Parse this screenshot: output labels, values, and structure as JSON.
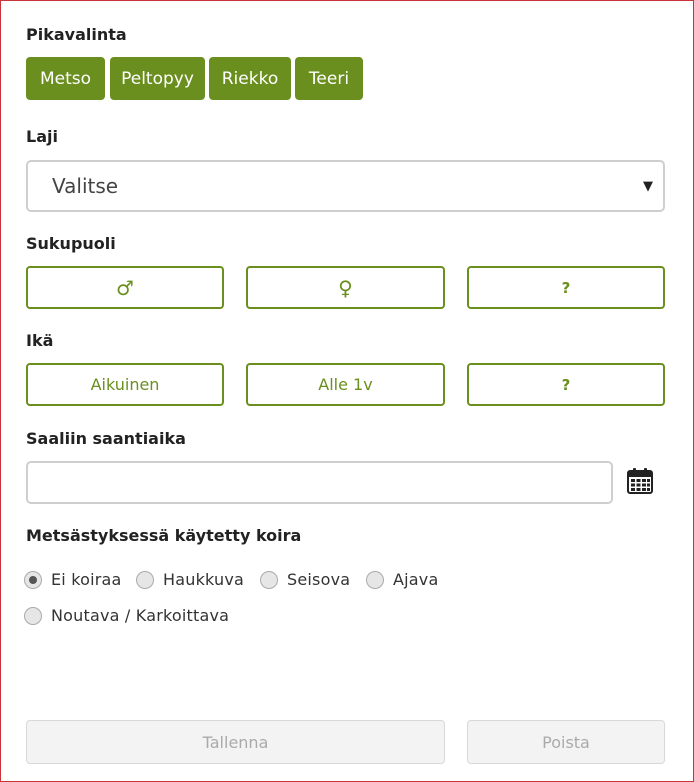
{
  "pikavalinta": {
    "label": "Pikavalinta",
    "buttons": [
      "Metso",
      "Peltopyy",
      "Riekko",
      "Teeri"
    ]
  },
  "laji": {
    "label": "Laji",
    "selected": "Valitse"
  },
  "sukupuoli": {
    "label": "Sukupuoli",
    "options": [
      "♂",
      "♀",
      "?"
    ]
  },
  "ika": {
    "label": "Ikä",
    "options": [
      "Aikuinen",
      "Alle 1v",
      "?"
    ]
  },
  "saantiaika": {
    "label": "Saaliin saantiaika",
    "value": "",
    "icon": "calendar-icon"
  },
  "koira": {
    "label": "Metsästyksessä käytetty koira",
    "options": [
      "Ei koiraa",
      "Haukkuva",
      "Seisova",
      "Ajava",
      "Noutava / Karkoittava"
    ],
    "selected_index": 0
  },
  "actions": {
    "save": "Tallenna",
    "delete": "Poista"
  },
  "colors": {
    "accent": "#6a8f1f",
    "disabled_bg": "#f3f3f3",
    "disabled_text": "#aaaaaa"
  }
}
